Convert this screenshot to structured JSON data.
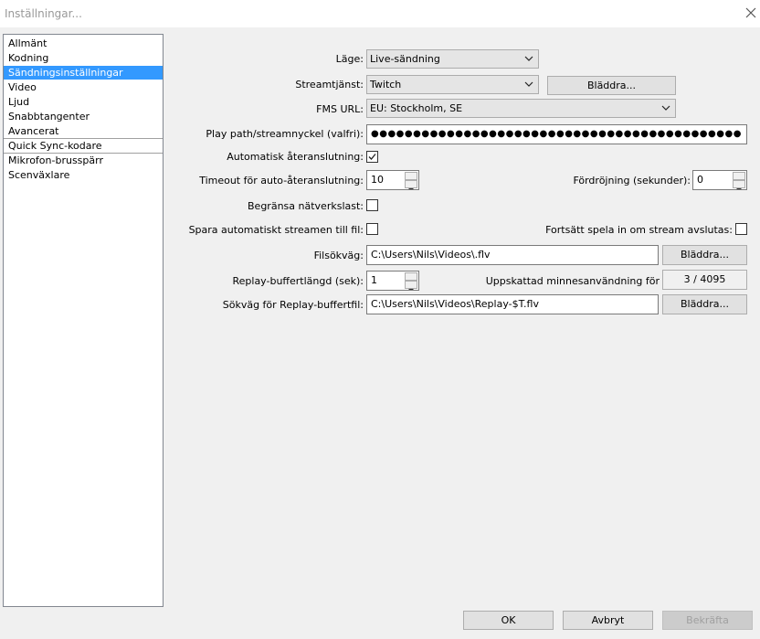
{
  "window": {
    "title": "Inställningar...",
    "close_icon": "close-icon"
  },
  "sidebar": {
    "items": [
      {
        "label": "Allmänt"
      },
      {
        "label": "Kodning"
      },
      {
        "label": "Sändningsinställningar"
      },
      {
        "label": "Video"
      },
      {
        "label": "Ljud"
      },
      {
        "label": "Snabbtangenter"
      },
      {
        "label": "Avancerat"
      },
      {
        "label": "Quick Sync-kodare"
      },
      {
        "label": "Mikrofon-brusspärr"
      },
      {
        "label": "Scenväxlare"
      }
    ],
    "selected_color": "#3399ff"
  },
  "form": {
    "mode_label": "Läge:",
    "mode_value": "Live-sändning",
    "service_label": "Streamtjänst:",
    "service_value": "Twitch",
    "service_browse": "Bläddra...",
    "fms_label": "FMS URL:",
    "fms_value": "EU: Stockholm, SE",
    "playpath_label": "Play path/streamnyckel (valfri):",
    "playpath_value": "●●●●●●●●●●●●●●●●●●●●●●●●●●●●●●●●●●●●●●●●●●●●",
    "autoreconnect_label": "Automatisk återanslutning:",
    "autoreconnect_checked": true,
    "timeout_label": "Timeout för auto-återanslutning:",
    "timeout_value": "10",
    "delay_label": "Fördröjning (sekunder):",
    "delay_value": "0",
    "limit_label": "Begränsa nätverkslast:",
    "limit_checked": false,
    "savefile_label": "Spara automatiskt streamen till fil:",
    "savefile_checked": false,
    "continue_label": "Fortsätt spela in om stream avslutas:",
    "continue_checked": false,
    "filepath_label": "Filsökväg:",
    "filepath_value": "C:\\Users\\Nils\\Videos\\.flv",
    "filepath_browse": "Bläddra...",
    "replay_len_label": "Replay-buffertlängd (sek):",
    "replay_len_value": "1",
    "mem_label": "Uppskattad minnesanvändning för",
    "mem_value": "3 / 4095",
    "replay_path_label": "Sökväg för Replay-buffertfil:",
    "replay_path_value": "C:\\Users\\Nils\\Videos\\Replay-$T.flv",
    "replay_path_browse": "Bläddra..."
  },
  "footer": {
    "ok": "OK",
    "cancel": "Avbryt",
    "apply": "Bekräfta"
  }
}
